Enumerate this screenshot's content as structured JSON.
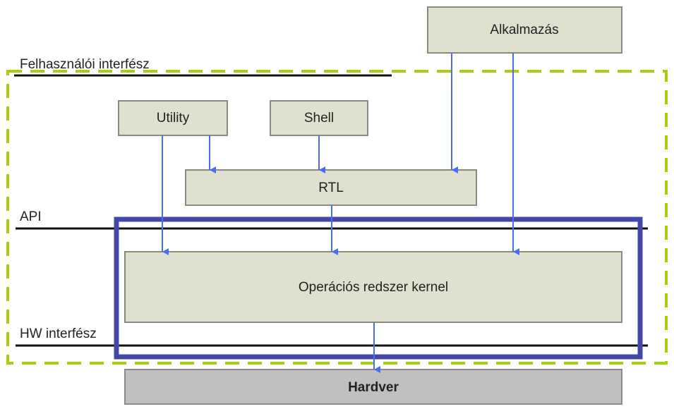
{
  "layers": {
    "user_interface": "Felhasználói interfész",
    "api": "API",
    "hw_interface": "HW interfész"
  },
  "boxes": {
    "application": "Alkalmazás",
    "utility": "Utility",
    "shell": "Shell",
    "rtl": "RTL",
    "kernel": "Operációs redszer kernel",
    "hardware": "Hardver"
  },
  "colors": {
    "dashed_boundary": "#a6d10a",
    "kernel_frame": "#4348a8",
    "arrow": "#4a6cf0",
    "box_fill": "#dfe0cd",
    "hardware_fill": "#c0c0c0"
  }
}
